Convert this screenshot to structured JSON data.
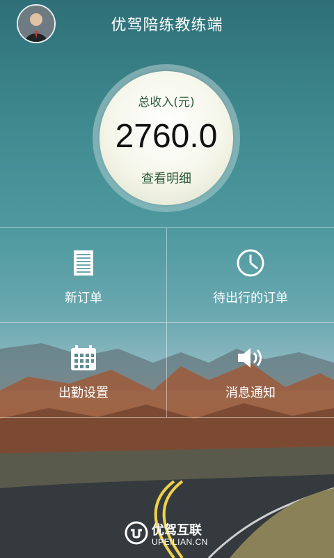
{
  "header": {
    "title": "优驾陪练教练端",
    "avatar_alt": "avatar"
  },
  "income": {
    "label": "总收入(元)",
    "value": "2760.0",
    "link": "查看明细"
  },
  "menu": [
    {
      "label": "新订单",
      "icon": "document-icon"
    },
    {
      "label": "待出行的订单",
      "icon": "clock-icon"
    },
    {
      "label": "出勤设置",
      "icon": "calendar-icon"
    },
    {
      "label": "消息通知",
      "icon": "speaker-icon"
    }
  ],
  "footer": {
    "brand": "优驾互联",
    "domain": "UPEILIAN.CN"
  }
}
